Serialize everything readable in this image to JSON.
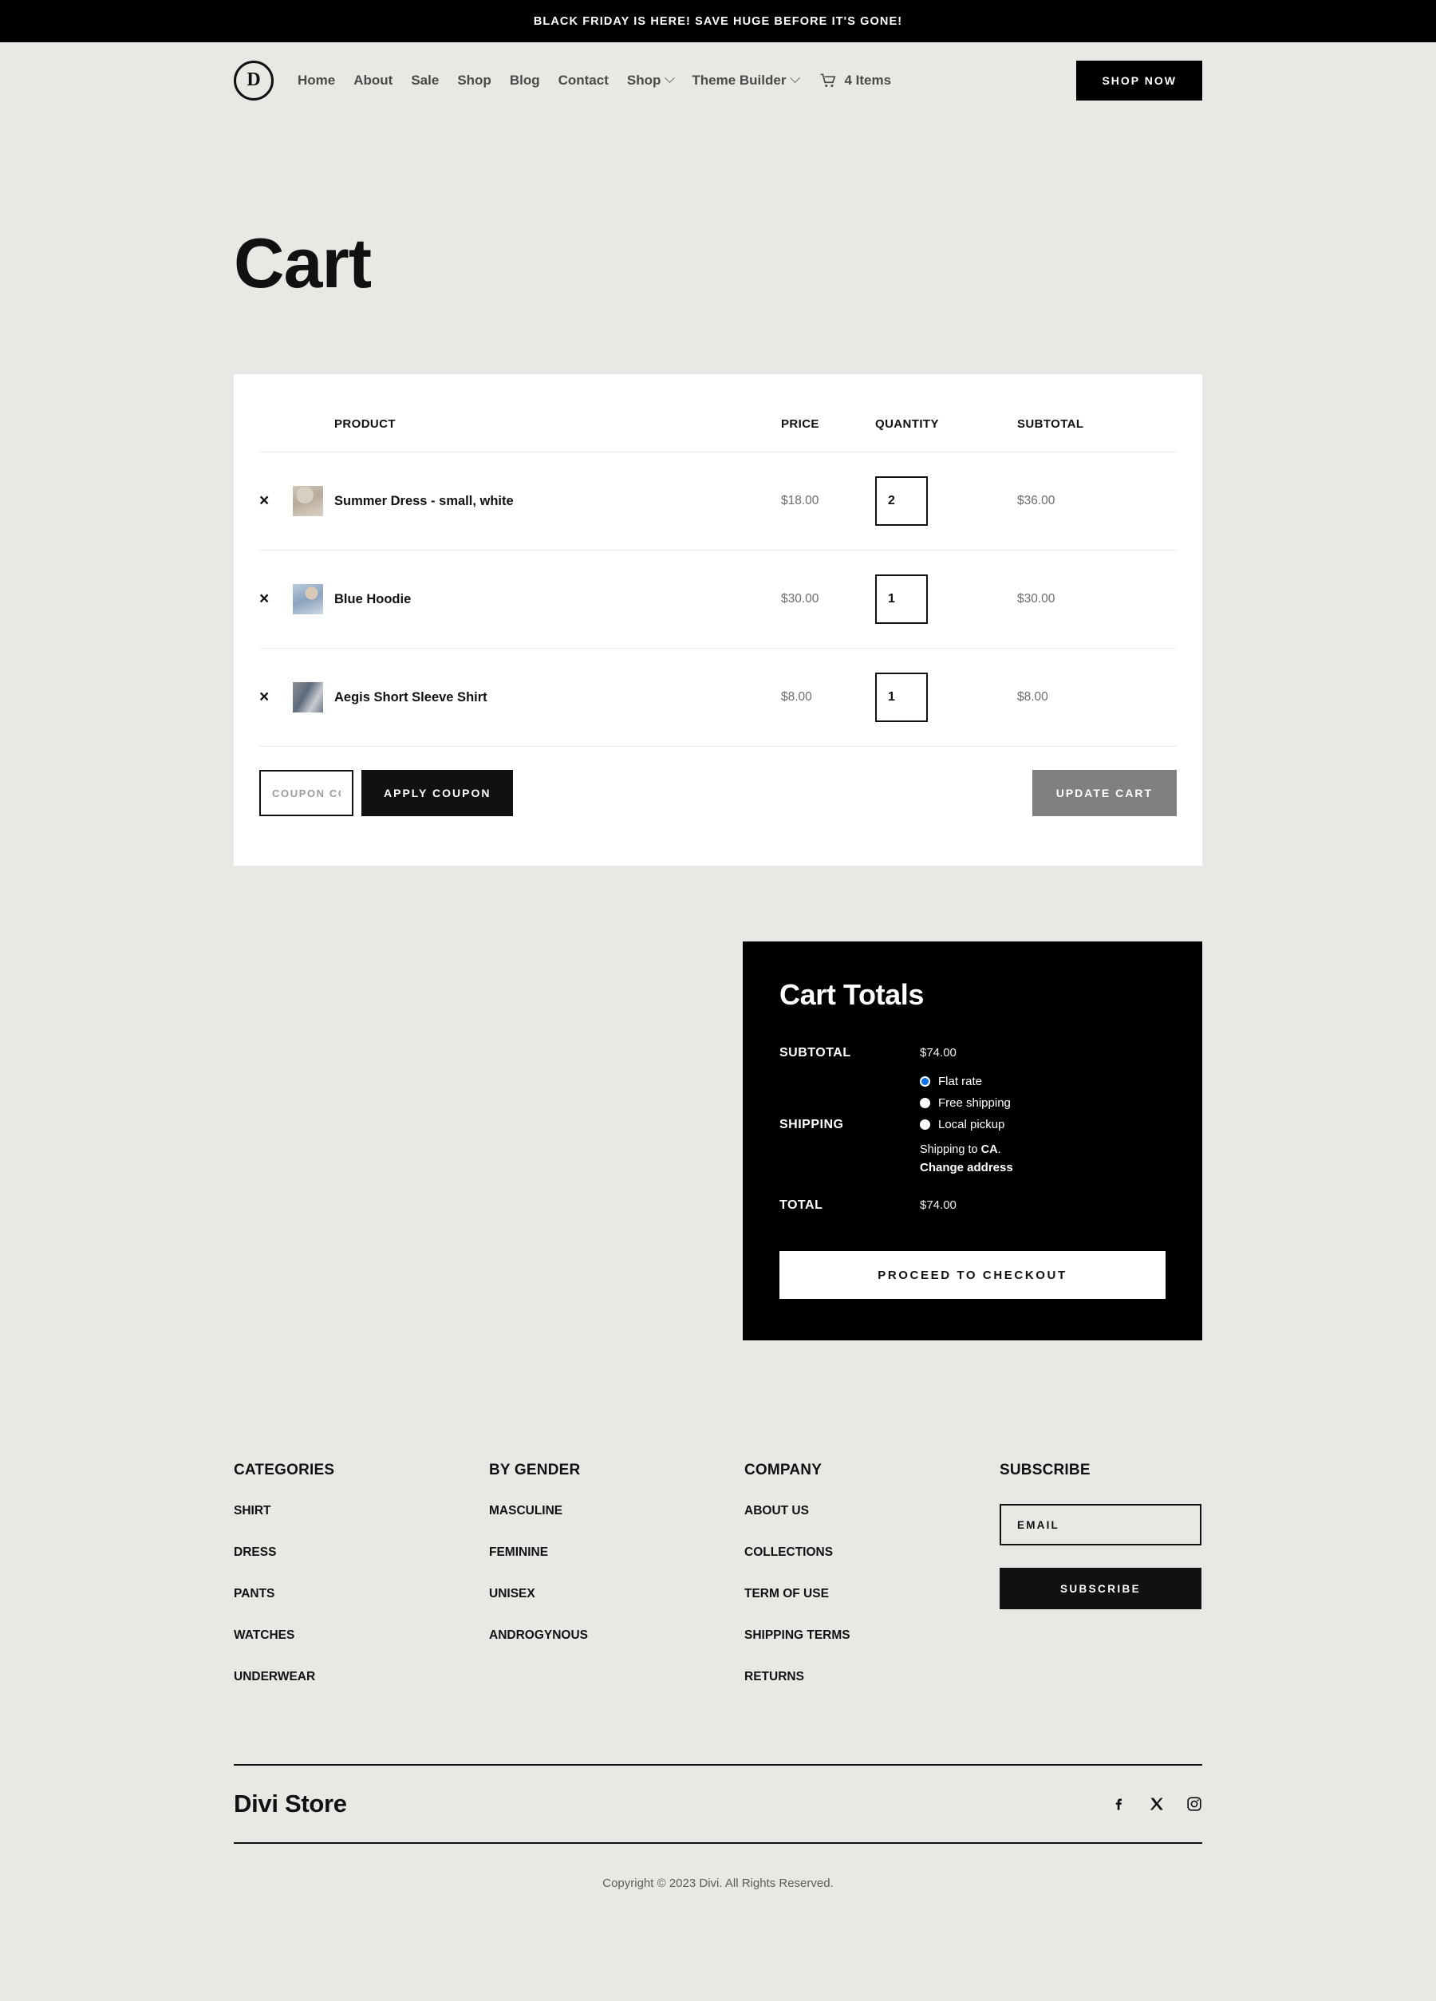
{
  "announcement": {
    "text": "Black Friday is here! Save huge before it's gone!"
  },
  "header": {
    "logo_letter": "D",
    "nav": [
      {
        "label": "Home",
        "has_dropdown": false
      },
      {
        "label": "About",
        "has_dropdown": false
      },
      {
        "label": "Sale",
        "has_dropdown": false
      },
      {
        "label": "Shop",
        "has_dropdown": false
      },
      {
        "label": "Blog",
        "has_dropdown": false
      },
      {
        "label": "Contact",
        "has_dropdown": false
      },
      {
        "label": "Shop",
        "has_dropdown": true
      },
      {
        "label": "Theme Builder",
        "has_dropdown": true
      }
    ],
    "cart_label": "4 Items",
    "shop_now_label": "Shop Now"
  },
  "page": {
    "title": "Cart"
  },
  "cart": {
    "columns": {
      "product": "Product",
      "price": "Price",
      "quantity": "Quantity",
      "subtotal": "Subtotal"
    },
    "items": [
      {
        "remove": "×",
        "name": "Summer Dress - small, white",
        "price": "$18.00",
        "qty": "2",
        "subtotal": "$36.00"
      },
      {
        "remove": "×",
        "name": "Blue Hoodie",
        "price": "$30.00",
        "qty": "1",
        "subtotal": "$30.00"
      },
      {
        "remove": "×",
        "name": "Aegis Short Sleeve Shirt",
        "price": "$8.00",
        "qty": "1",
        "subtotal": "$8.00"
      }
    ],
    "coupon_placeholder": "Coupon code",
    "coupon_value": "",
    "apply_coupon_label": "Apply Coupon",
    "update_cart_label": "Update Cart"
  },
  "totals": {
    "title": "Cart Totals",
    "subtotal_label": "Subtotal",
    "subtotal_value": "$74.00",
    "shipping_label": "Shipping",
    "shipping_options": [
      {
        "label": "Flat rate",
        "selected": true
      },
      {
        "label": "Free shipping",
        "selected": false
      },
      {
        "label": "Local pickup",
        "selected": false
      }
    ],
    "shipping_to_prefix": "Shipping to ",
    "shipping_to_region": "CA",
    "shipping_to_suffix": ".",
    "change_address_label": "Change address",
    "total_label": "Total",
    "total_value": "$74.00",
    "checkout_label": "Proceed to checkout",
    "selected_radio_color": "#0b72e7"
  },
  "footer": {
    "columns": [
      {
        "heading": "Categories",
        "links": [
          "Shirt",
          "Dress",
          "Pants",
          "Watches",
          "Underwear"
        ]
      },
      {
        "heading": "By Gender",
        "links": [
          "Masculine",
          "Feminine",
          "Unisex",
          "Androgynous"
        ]
      },
      {
        "heading": "Company",
        "links": [
          "About Us",
          "Collections",
          "Term of Use",
          "Shipping Terms",
          "Returns"
        ]
      }
    ],
    "subscribe": {
      "heading": "Subscribe",
      "email_placeholder": "Email",
      "email_value": "",
      "button_label": "Subscribe"
    },
    "brand": "Divi Store",
    "socials": [
      "facebook-icon",
      "x-twitter-icon",
      "instagram-icon"
    ],
    "copyright": "Copyright © 2023 Divi. All Rights Reserved."
  }
}
